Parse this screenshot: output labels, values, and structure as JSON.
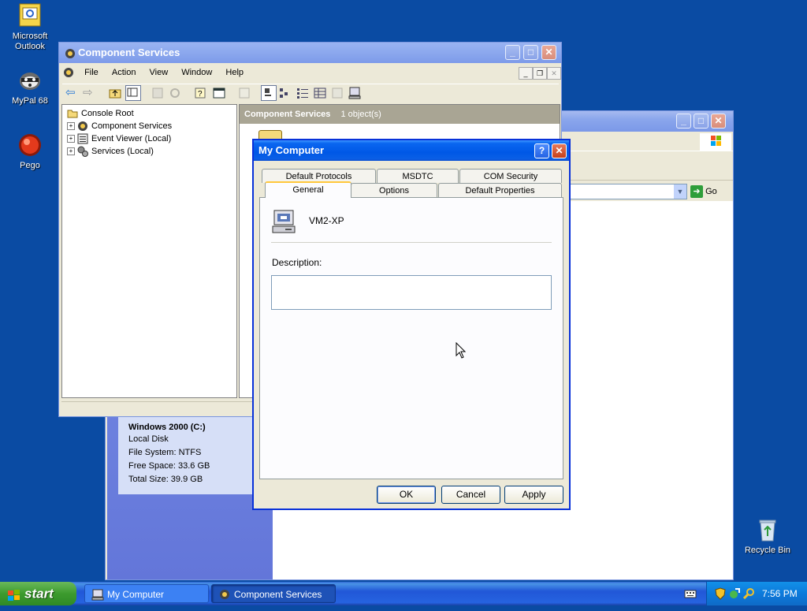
{
  "desktop": {
    "icons": [
      {
        "label_line1": "Microsoft",
        "label_line2": "Outlook"
      },
      {
        "label_line1": "MyPal 68",
        "label_line2": ""
      },
      {
        "label_line1": "Pego",
        "label_line2": ""
      },
      {
        "label_line1": "Recycle Bin",
        "label_line2": ""
      }
    ]
  },
  "my_computer_window": {
    "go_label": "Go",
    "drive": {
      "name": "Windows 2000 (C:)",
      "type": "Local Disk",
      "file_system": "File System: NTFS",
      "free_space": "Free Space: 33.6 GB",
      "total_size": "Total Size: 39.9 GB"
    }
  },
  "component_services": {
    "title": "Component Services",
    "menu": [
      "File",
      "Action",
      "View",
      "Window",
      "Help"
    ],
    "tree": [
      {
        "label": "Console Root",
        "icon": "folder-icon"
      },
      {
        "label": "Component Services",
        "icon": "component-services-icon"
      },
      {
        "label": "Event Viewer (Local)",
        "icon": "event-viewer-icon"
      },
      {
        "label": "Services (Local)",
        "icon": "gears-icon"
      }
    ],
    "right_header": {
      "title": "Component Services",
      "count": "1 object(s)"
    }
  },
  "dialog": {
    "title": "My Computer",
    "tabs_back": [
      "Default Protocols",
      "MSDTC",
      "COM Security"
    ],
    "tabs_front": [
      "General",
      "Options",
      "Default Properties"
    ],
    "computer_name": "VM2-XP",
    "description_label": "Description:",
    "description_value": "",
    "buttons": {
      "ok": "OK",
      "cancel": "Cancel",
      "apply": "Apply"
    }
  },
  "taskbar": {
    "start_label": "start",
    "tasks": [
      {
        "label": "My Computer",
        "active": false
      },
      {
        "label": "Component Services",
        "active": true
      }
    ],
    "clock": "7:56 PM"
  },
  "colors": {
    "desktop": "#0a4ba3",
    "titlebar_active": "#0058e6",
    "dialog_face": "#ece9d8",
    "start_green": "#3c9b2e"
  }
}
